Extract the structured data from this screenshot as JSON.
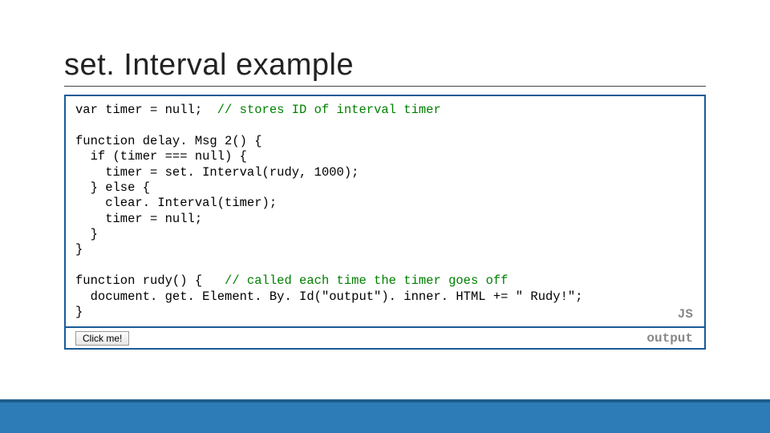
{
  "title": "set. Interval example",
  "code": {
    "line1a": "var timer = null;  ",
    "line1b": "// stores ID of interval timer",
    "blank1": "",
    "line2": "function delay. Msg 2() {",
    "line3": "  if (timer === null) {",
    "line4": "    timer = set. Interval(rudy, 1000);",
    "line5": "  } else {",
    "line6": "    clear. Interval(timer);",
    "line7": "    timer = null;",
    "line8": "  }",
    "line9": "}",
    "blank2": "",
    "line10a": "function rudy() {   ",
    "line10b": "// called each time the timer goes off",
    "line11": "  document. get. Element. By. Id(\"output\"). inner. HTML += \" Rudy!\";",
    "line12": "}"
  },
  "labels": {
    "js": "JS",
    "output": "output"
  },
  "button": "Click me!"
}
